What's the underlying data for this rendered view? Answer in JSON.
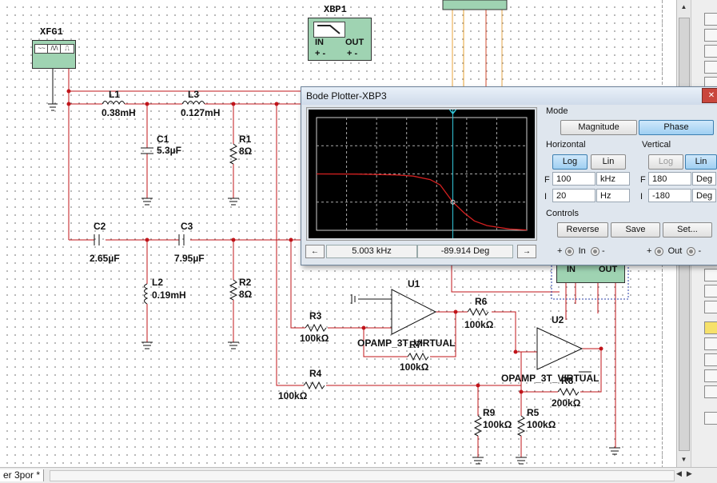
{
  "schematic": {
    "xfg": {
      "name": "XFG1",
      "waves": [
        "~~",
        "/\\/\\",
        "⎍"
      ]
    },
    "xbp1": {
      "name": "XBP1",
      "in": "IN",
      "out": "OUT",
      "in_pins": "+ -",
      "out_pins": "+ -"
    },
    "xbp3_label_in": "IN",
    "xbp3_label_out": "OUT",
    "components": [
      {
        "id": "L1",
        "value": "0.38mH"
      },
      {
        "id": "L3",
        "value": "0.127mH"
      },
      {
        "id": "C1",
        "value": "5.3µF"
      },
      {
        "id": "R1",
        "value": "8Ω"
      },
      {
        "id": "C2",
        "value": "2.65µF"
      },
      {
        "id": "C3",
        "value": "7.95µF"
      },
      {
        "id": "L2",
        "value": "0.19mH"
      },
      {
        "id": "R2",
        "value": "8Ω"
      },
      {
        "id": "R3",
        "value": "100kΩ"
      },
      {
        "id": "R4",
        "value": "100kΩ"
      },
      {
        "id": "R6",
        "value": "100kΩ"
      },
      {
        "id": "R7",
        "value": "100kΩ"
      },
      {
        "id": "R8",
        "value": "200kΩ"
      },
      {
        "id": "R9",
        "value": "100kΩ"
      },
      {
        "id": "R5",
        "value": "100kΩ"
      }
    ],
    "opamps": [
      {
        "id": "U1",
        "model": "OPAMP_3T_VIRTUAL"
      },
      {
        "id": "U2",
        "model": "OPAMP_3T_VIRTUAL"
      }
    ]
  },
  "bode": {
    "title": "Bode Plotter-XBP3",
    "close": "✕",
    "mode_label": "Mode",
    "magnitude_btn": "Magnitude",
    "phase_btn": "Phase",
    "active_mode": "Phase",
    "horizontal_label": "Horizontal",
    "vertical_label": "Vertical",
    "h_log": "Log",
    "h_lin": "Lin",
    "v_log": "Log",
    "v_lin": "Lin",
    "h_F_label": "F",
    "h_F_value": "100",
    "h_F_unit": "kHz",
    "h_I_label": "I",
    "h_I_value": "20",
    "h_I_unit": "Hz",
    "v_F_label": "F",
    "v_F_value": "180",
    "v_F_unit": "Deg",
    "v_I_label": "I",
    "v_I_value": "-180",
    "v_I_unit": "Deg",
    "controls_label": "Controls",
    "reverse_btn": "Reverse",
    "save_btn": "Save",
    "set_btn": "Set...",
    "cursor_freq": "5.003 kHz",
    "cursor_value": "-89.914 Deg",
    "in_label": "In",
    "out_label": "Out",
    "plus": "+",
    "minus": "-",
    "trace_color": "#d42020",
    "cursor_color": "#34c6d8"
  },
  "statusbar": {
    "doc_tab": "er 3por *"
  },
  "chart_data": {
    "type": "line",
    "x_scale": "log",
    "xlim": [
      20,
      100000
    ],
    "ylim": [
      -180,
      180
    ],
    "xunit": "Hz",
    "yunit": "Deg",
    "grid": true,
    "cursor": {
      "x": 5003,
      "y": -89.914
    },
    "series": [
      {
        "x": [
          20,
          100,
          500,
          1000,
          2000,
          3000,
          5003,
          8000,
          12000,
          20000,
          50000,
          100000
        ],
        "y": [
          0,
          -0.5,
          -3,
          -7,
          -18,
          -35,
          -89.914,
          -125,
          -150,
          -165,
          -176,
          -179
        ]
      }
    ]
  }
}
